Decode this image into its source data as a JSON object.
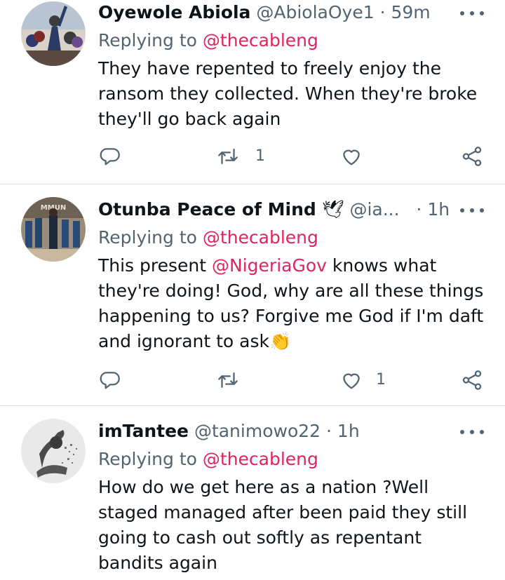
{
  "tweets": [
    {
      "name": "Oyewole Abiola",
      "handle": "@AbiolaOye1",
      "separator": "·",
      "time": "59m",
      "replying_prefix": "Replying to ",
      "replying_to": "@thecableng",
      "text": "They have repented to freely enjoy the ransom they collected. When they're broke they'll go back again",
      "retweet_count": "1",
      "like_count": ""
    },
    {
      "name": "Otunba Peace of Mind",
      "name_emoji": "🕊",
      "handle": "@ia...",
      "separator": "·",
      "time": "1h",
      "replying_prefix": "Replying to ",
      "replying_to": "@thecableng",
      "text_prefix": "This present ",
      "text_mention": "@NigeriaGov",
      "text_suffix": " knows what they're doing! God, why are all these things happening to us? Forgive me God if I'm daft and ignorant to ask",
      "text_emoji": "👏",
      "retweet_count": "",
      "like_count": "1"
    },
    {
      "name": "imTantee",
      "handle": "@tanimowo22",
      "separator": "·",
      "time": "1h",
      "replying_prefix": "Replying to ",
      "replying_to": "@thecableng",
      "text": "How do we get here as a nation ?Well staged managed after been paid they still going to cash out softly as repentant bandits again"
    }
  ],
  "icons": {
    "reply": "reply-icon",
    "retweet": "retweet-icon",
    "like": "heart-icon",
    "share": "share-icon",
    "more": "more-options-icon"
  },
  "colors": {
    "mention": "#e0245e",
    "secondary_text": "#536471",
    "primary_text": "#0f1419",
    "divider": "#dfe3e6"
  }
}
